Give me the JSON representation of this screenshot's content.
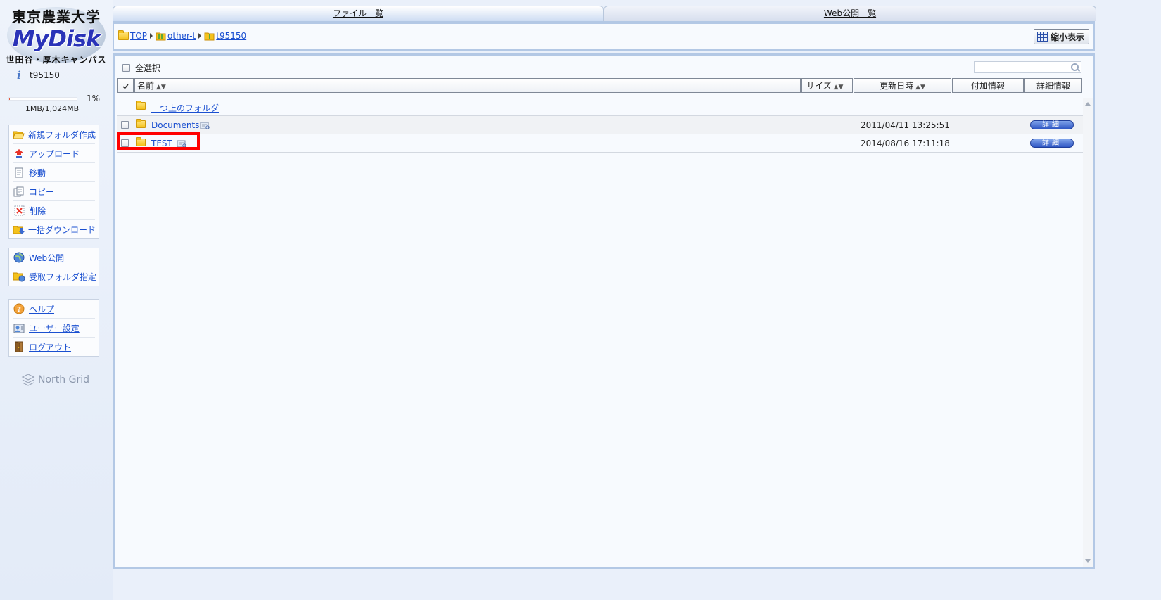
{
  "sidebar": {
    "logo": {
      "kanji": "東京農業大学",
      "title": "MyDisk",
      "campus": "世田谷・厚木キャンパス"
    },
    "user": {
      "name": "t95150",
      "icon": "info-icon"
    },
    "quota": {
      "percent_label": "1%",
      "percent": 1,
      "size": "1MB/1,024MB"
    },
    "menu_main": [
      {
        "label": "新規フォルダ作成",
        "icon": "new-folder-icon"
      },
      {
        "label": "アップロード",
        "icon": "upload-icon"
      },
      {
        "label": "移動",
        "icon": "move-icon"
      },
      {
        "label": "コピー",
        "icon": "copy-icon"
      },
      {
        "label": "削除",
        "icon": "delete-icon"
      },
      {
        "label": "一括ダウンロード",
        "icon": "bulk-download-icon"
      }
    ],
    "menu_web": [
      {
        "label": "Web公開",
        "icon": "globe-icon"
      },
      {
        "label": "受取フォルダ指定",
        "icon": "receive-folder-icon"
      }
    ],
    "menu_other": [
      {
        "label": "ヘルプ",
        "icon": "help-icon"
      },
      {
        "label": "ユーザー設定",
        "icon": "user-settings-icon"
      },
      {
        "label": "ログアウト",
        "icon": "logout-icon"
      }
    ],
    "brand": "North Grid"
  },
  "tabs": {
    "files": "ファイル一覧",
    "web": "Web公開一覧"
  },
  "breadcrumb": [
    "TOP",
    "other-t",
    "t95150"
  ],
  "toolbar": {
    "shrink_label": "縮小表示"
  },
  "list": {
    "select_all": "全選択",
    "search_placeholder": "",
    "columns": {
      "name": "名前",
      "size": "サイズ",
      "updated": "更新日時",
      "extra": "付加情報",
      "detail": "詳細情報",
      "sort_arrows": "▲▼"
    },
    "parent_folder": "一つ上のフォルダ",
    "rows": [
      {
        "name": "Documents",
        "date": "2011/04/11 13:25:51",
        "detail": "詳細"
      },
      {
        "name": "TEST",
        "date": "2014/08/16 17:11:18",
        "detail": "詳細"
      }
    ]
  },
  "colors": {
    "accent": "#1a4fd0",
    "highlight": "#ff0000",
    "frame": "#b3c8e5"
  }
}
